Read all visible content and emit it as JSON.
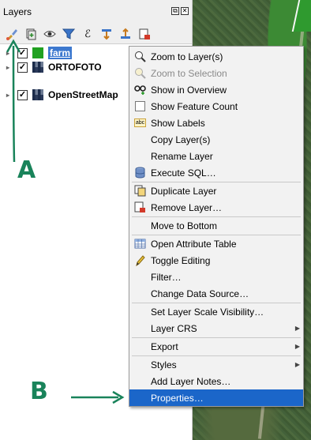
{
  "panel": {
    "title": "Layers",
    "float_glyph": "⧉",
    "close_glyph": "✕"
  },
  "toolbar": {
    "buttons": [
      "paintbrush-icon",
      "add-group-icon",
      "eye-icon",
      "filter-icon",
      "expression-icon",
      "expand-icon",
      "collapse-icon",
      "remove-icon"
    ],
    "expression_glyph": "ℰ"
  },
  "layers": [
    {
      "name": "farm",
      "checked": true,
      "selected": true,
      "swatch": "#21a121"
    },
    {
      "name": "ORTOFOTO",
      "checked": true,
      "selected": false
    },
    {
      "name": "OpenStreetMap",
      "checked": true,
      "selected": false
    }
  ],
  "checkmark": "✓",
  "expander": "▸",
  "menu": {
    "items": [
      {
        "label": "Zoom to Layer(s)",
        "icon": "zoom-layer-icon",
        "glyph": "⌕",
        "disabled": false
      },
      {
        "label": "Zoom to Selection",
        "icon": "zoom-selection-icon",
        "glyph": "⌕",
        "disabled": true
      },
      {
        "label": "Show in Overview",
        "icon": "overview-icon",
        "glyph": "👓",
        "disabled": false
      },
      {
        "label": "Show Feature Count",
        "icon": "feature-count-checkbox",
        "glyph": "",
        "disabled": false
      },
      {
        "label": "Show Labels",
        "icon": "labels-icon",
        "glyph": "abc",
        "disabled": false
      },
      {
        "label": "Copy Layer(s)",
        "icon": "",
        "glyph": "",
        "disabled": false
      },
      {
        "label": "Rename Layer",
        "icon": "",
        "glyph": "",
        "disabled": false
      },
      {
        "label": "Execute SQL…",
        "icon": "database-icon",
        "glyph": "🗄",
        "disabled": false
      },
      {
        "label": "Duplicate Layer",
        "icon": "duplicate-icon",
        "glyph": "❐",
        "disabled": false
      },
      {
        "label": "Remove Layer…",
        "icon": "remove-layer-icon",
        "glyph": "🗑",
        "disabled": false
      },
      {
        "label": "Move to Bottom",
        "icon": "",
        "glyph": "",
        "disabled": false
      },
      {
        "label": "Open Attribute Table",
        "icon": "table-icon",
        "glyph": "▦",
        "disabled": false
      },
      {
        "label": "Toggle Editing",
        "icon": "pencil-icon",
        "glyph": "✎",
        "disabled": false
      },
      {
        "label": "Filter…",
        "icon": "",
        "glyph": "",
        "disabled": false
      },
      {
        "label": "Change Data Source…",
        "icon": "",
        "glyph": "",
        "disabled": false
      },
      {
        "label": "Set Layer Scale Visibility…",
        "icon": "",
        "glyph": "",
        "disabled": false
      },
      {
        "label": "Layer CRS",
        "icon": "",
        "glyph": "",
        "disabled": false,
        "submenu": true
      },
      {
        "label": "Export",
        "icon": "",
        "glyph": "",
        "disabled": false,
        "submenu": true
      },
      {
        "label": "Styles",
        "icon": "",
        "glyph": "",
        "disabled": false,
        "submenu": true
      },
      {
        "label": "Add Layer Notes…",
        "icon": "",
        "glyph": "",
        "disabled": false
      },
      {
        "label": "Properties…",
        "icon": "",
        "glyph": "",
        "disabled": false,
        "highlighted": true
      }
    ],
    "submenu_glyph": "▶"
  },
  "annotations": {
    "a": "A",
    "b": "B",
    "color": "#19835a"
  }
}
